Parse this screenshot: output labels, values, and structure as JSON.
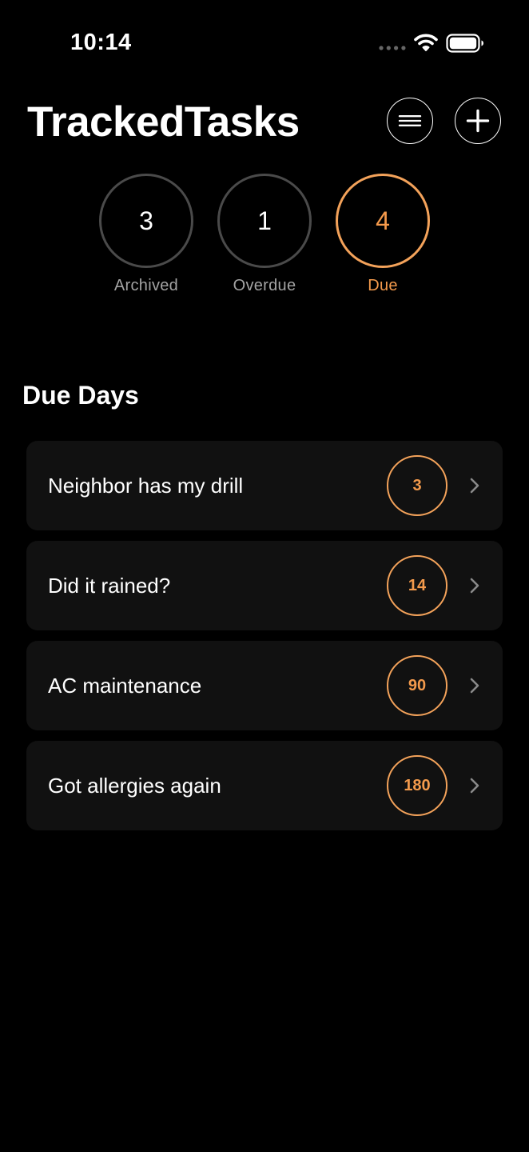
{
  "status_bar": {
    "time": "10:14",
    "icons": [
      "signal-icon",
      "wifi-icon",
      "battery-icon"
    ]
  },
  "header": {
    "title": "TrackedTasks",
    "menu_icon": "list-icon",
    "add_icon": "plus-icon"
  },
  "summary": [
    {
      "count": "3",
      "label": "Archived",
      "active": false
    },
    {
      "count": "1",
      "label": "Overdue",
      "active": false
    },
    {
      "count": "4",
      "label": "Due",
      "active": true
    }
  ],
  "section": {
    "title": "Due Days"
  },
  "tasks": [
    {
      "name": "Neighbor has my drill",
      "days": "3"
    },
    {
      "name": "Did it rained?",
      "days": "14"
    },
    {
      "name": "AC maintenance",
      "days": "90"
    },
    {
      "name": "Got allergies again",
      "days": "180"
    }
  ],
  "colors": {
    "background": "#000000",
    "accent": "#F59A4B",
    "row_background": "#111111",
    "inactive_ring": "#4A4A4A",
    "secondary_text": "#A3A3A3"
  }
}
